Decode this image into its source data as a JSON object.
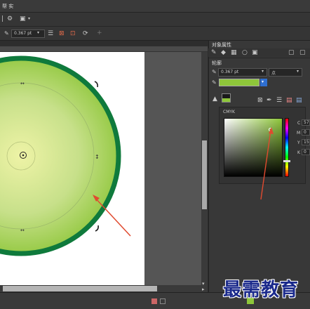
{
  "menubar": {
    "label": "帮 实"
  },
  "propbar": {
    "outline_width": "0.367 pt"
  },
  "panel": {
    "title": "对象属性",
    "outline_label": "轮廓",
    "outline_width": "0.367 pt",
    "unit": "点",
    "color_model": "CMYK",
    "cmyk_labels": [
      "C",
      "M",
      "Y",
      "K"
    ],
    "cmyk_values": [
      "57",
      "0",
      "15",
      "0"
    ]
  },
  "colors": {
    "fill_color": "#8ec63a",
    "outline_color": "#0f7a3c",
    "arrow_color": "#e04a2f"
  },
  "watermark": "最需教育"
}
